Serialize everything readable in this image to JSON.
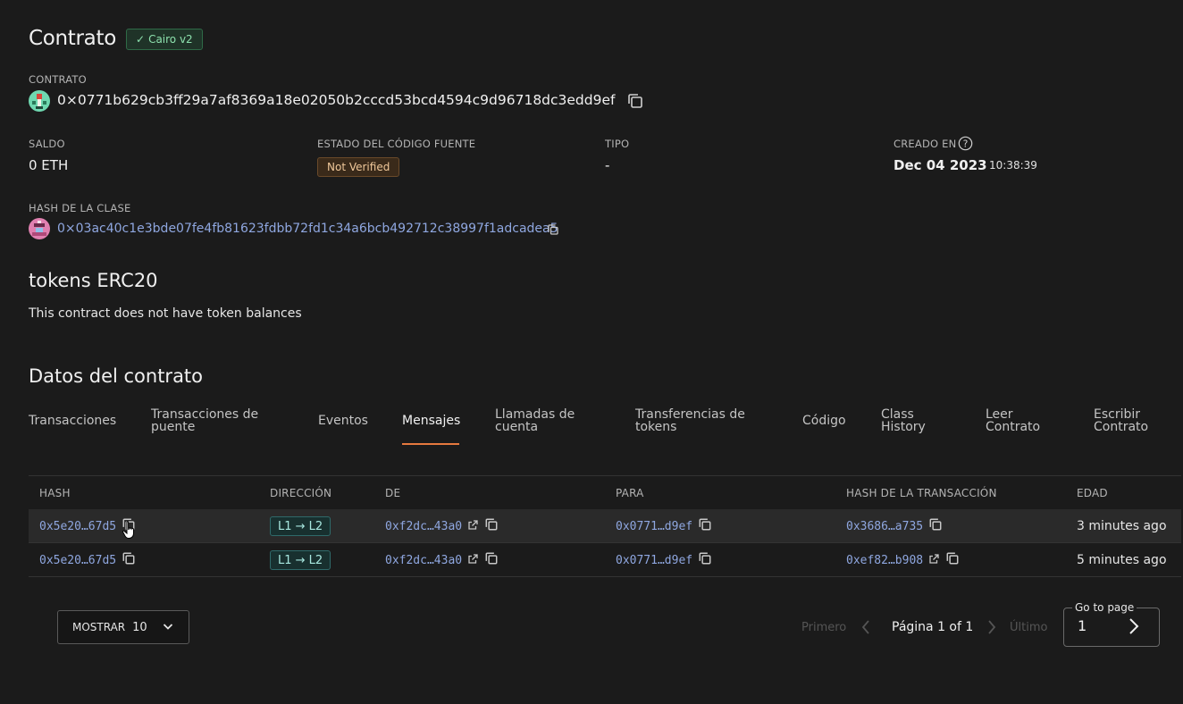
{
  "header": {
    "title": "Contrato",
    "badge": "Cairo v2"
  },
  "contract": {
    "label": "CONTRATO",
    "address": "0×0771b629cb3ff29a7af8369a18e02050b2cccd53bcd4594c9d96718dc3edd9ef"
  },
  "info": {
    "balance_label": "SALDO",
    "balance_value": "0 ETH",
    "source_label": "ESTADO DEL CÓDIGO FUENTE",
    "source_value": "Not Verified",
    "type_label": "TIPO",
    "type_value": "-",
    "created_label": "CREADO EN",
    "created_date": "Dec 04 2023",
    "created_time": "10:38:39"
  },
  "class_hash": {
    "label": "HASH DE LA CLASE",
    "value": "0×03ac40c1e3bde07fe4fb81623fdbb72fd1c34a6bcb492712c38997f1adcadea5"
  },
  "tokens": {
    "title": "tokens ERC20",
    "empty_text": "This contract does not have token balances"
  },
  "contract_data": {
    "title": "Datos del contrato",
    "tabs": [
      {
        "line1": "Transacciones",
        "line2": ""
      },
      {
        "line1": "Transacciones de",
        "line2": "puente"
      },
      {
        "line1": "Eventos",
        "line2": ""
      },
      {
        "line1": "Mensajes",
        "line2": ""
      },
      {
        "line1": "Llamadas de",
        "line2": "cuenta"
      },
      {
        "line1": "Transferencias de",
        "line2": "tokens"
      },
      {
        "line1": "Código",
        "line2": ""
      },
      {
        "line1": "Class",
        "line2": "History"
      },
      {
        "line1": "Leer",
        "line2": "Contrato"
      },
      {
        "line1": "Escribir",
        "line2": "Contrato"
      }
    ],
    "active_tab": "Mensajes"
  },
  "table": {
    "headers": [
      "HASH",
      "DIRECCIÓN",
      "DE",
      "PARA",
      "HASH DE LA TRANSACCIÓN",
      "EDAD"
    ],
    "rows": [
      {
        "hash": "0x5e20…67d5",
        "direction": "L1 → L2",
        "from": "0xf2dc…43a0",
        "to": "0x0771…d9ef",
        "tx_hash": "0x3686…a735",
        "age": "3 minutes ago"
      },
      {
        "hash": "0x5e20…67d5",
        "direction": "L1 → L2",
        "from": "0xf2dc…43a0",
        "to": "0x0771…d9ef",
        "tx_hash": "0xef82…b908",
        "age": "5 minutes ago"
      }
    ]
  },
  "pagination": {
    "show_label": "MOSTRAR",
    "show_value": "10",
    "first": "Primero",
    "page_text": "Página 1 of 1",
    "last": "Último",
    "goto_label": "Go to page",
    "goto_value": "1"
  },
  "colors": {
    "background": "#1b1b1b",
    "accent_tab": "#e6793e",
    "link": "#8fa7e0",
    "badge_green": "#8de0ad"
  }
}
